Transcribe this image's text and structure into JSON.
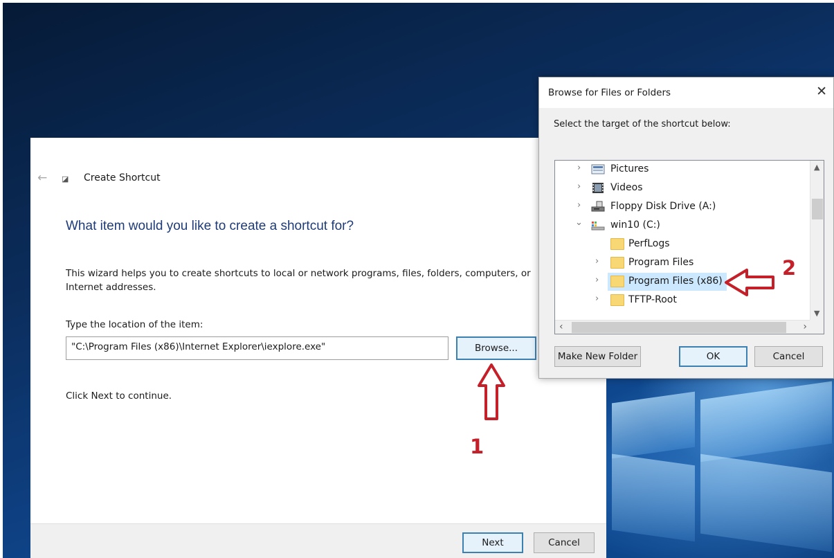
{
  "wizard": {
    "window_title": "Create Shortcut",
    "heading": "What item would you like to create a shortcut for?",
    "description": "This wizard helps you to create shortcuts to local or network programs, files, folders, computers, or Internet addresses.",
    "location_label": "Type the location of the item:",
    "location_value": "\"C:\\Program Files (x86)\\Internet Explorer\\iexplore.exe\"",
    "browse_label": "Browse...",
    "continue_text": "Click Next to continue.",
    "next_label": "Next",
    "cancel_label": "Cancel"
  },
  "browse_dialog": {
    "title": "Browse for Files or Folders",
    "close_glyph": "✕",
    "prompt": "Select the target of the shortcut below:",
    "tree": [
      {
        "label": "Pictures",
        "icon": "pictures-icon",
        "expandable": true
      },
      {
        "label": "Videos",
        "icon": "videos-icon",
        "expandable": true
      },
      {
        "label": "Floppy Disk Drive (A:)",
        "icon": "floppy-drive-icon",
        "expandable": true
      },
      {
        "label": "win10 (C:)",
        "icon": "hard-drive-icon",
        "expanded": true
      },
      {
        "label": "PerfLogs",
        "icon": "folder-icon",
        "expandable": false
      },
      {
        "label": "Program Files",
        "icon": "folder-icon",
        "expandable": true
      },
      {
        "label": "Program Files (x86)",
        "icon": "folder-icon",
        "expandable": true,
        "selected": true
      },
      {
        "label": "TFTP-Root",
        "icon": "folder-icon",
        "expandable": true
      }
    ],
    "make_new_folder_label": "Make New Folder",
    "ok_label": "OK",
    "cancel_label": "Cancel"
  },
  "annotations": {
    "step1": "1",
    "step2": "2",
    "color": "#c3202a"
  }
}
